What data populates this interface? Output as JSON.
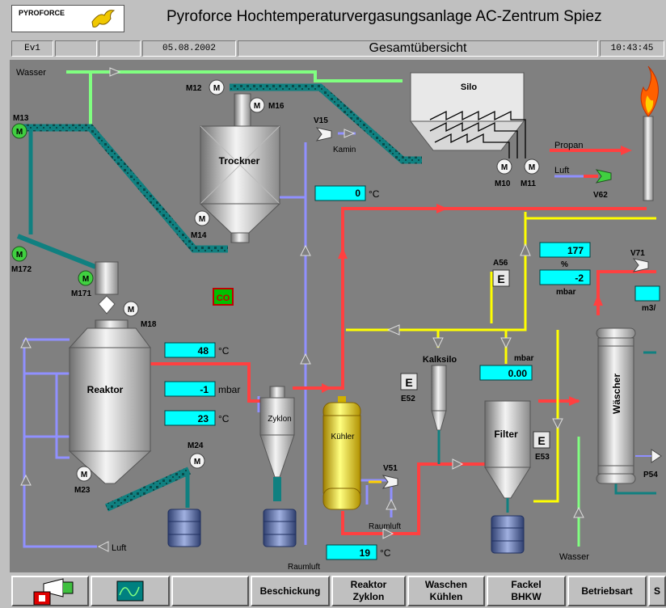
{
  "header": {
    "logo_text": "PYROFORCE",
    "title": "Pyroforce Hochtemperaturvergasungsanlage AC-Zentrum Spiez"
  },
  "infobar": {
    "ev": "Ev1",
    "date": "05.08.2002",
    "view_title": "Gesamtübersicht",
    "time": "10:43:45"
  },
  "labels": {
    "wasser_top": "Wasser",
    "wasser_bottom": "Wasser",
    "silo": "Silo",
    "trockner": "Trockner",
    "reaktor": "Reaktor",
    "zyklon": "Zyklon",
    "kuehler": "Kühler",
    "kalksilo": "Kalksilo",
    "filter": "Filter",
    "waescher": "Wäscher",
    "propan": "Propan",
    "luft_top": "Luft",
    "luft_bottom": "Luft",
    "kamin": "Kamin",
    "raumluft1": "Raumluft",
    "raumluft2": "Raumluft",
    "co": "CO",
    "mbar_filter": "mbar",
    "percent": "%",
    "mbar_a": "mbar",
    "m3": "m3/"
  },
  "motors": {
    "m10": "M10",
    "m11": "M11",
    "m12": "M12",
    "m13": "M13",
    "m14": "M14",
    "m16": "M16",
    "m17": "M172",
    "m171": "M171",
    "m18": "M18",
    "m23": "M23",
    "m24": "M24",
    "m": "M"
  },
  "valves": {
    "v15": "V15",
    "v51": "V51",
    "v62": "V62",
    "v71": "V71",
    "p54": "P54",
    "a56": "A56",
    "e52": "E52",
    "e53": "E53",
    "e": "E"
  },
  "readings": {
    "trockner_temp": {
      "value": "0",
      "unit": "°C"
    },
    "reaktor_temp": {
      "value": "48",
      "unit": "°C"
    },
    "reaktor_pressure": {
      "value": "-1",
      "unit": "mbar"
    },
    "reaktor_temp2": {
      "value": "23",
      "unit": "°C"
    },
    "filter_pressure": {
      "value": "0.00"
    },
    "percent_value": {
      "value": "177"
    },
    "mbar_value": {
      "value": "-2"
    },
    "kuehler_temp": {
      "value": "19",
      "unit": "°C"
    }
  },
  "buttons": {
    "beschickung": "Beschickung",
    "reaktor_zyklon": "Reaktor\nZyklon",
    "waschen_kuehlen": "Waschen\nKühlen",
    "fackel_bhkw": "Fackel\nBHKW",
    "betriebsart": "Betriebsart",
    "s": "S"
  },
  "colors": {
    "canvas": "#808080",
    "water_line": "#80ff80",
    "hot_gas_line": "#ff4040",
    "air_line": "#9090ff",
    "yellow_line": "#ffff00",
    "conveyor": "#108080",
    "readout_bg": "#00ffff"
  }
}
